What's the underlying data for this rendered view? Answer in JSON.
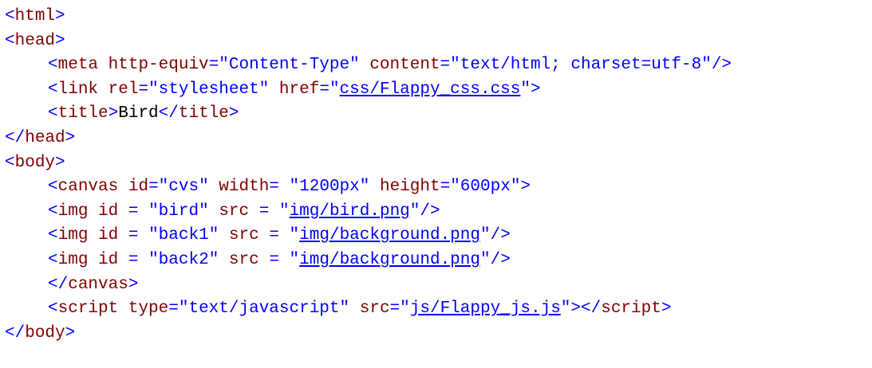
{
  "editor": {
    "lines": [
      {
        "indent": 0,
        "tokens": [
          {
            "kind": "punct",
            "text": "<"
          },
          {
            "kind": "tag",
            "text": "html"
          },
          {
            "kind": "punct",
            "text": ">"
          }
        ]
      },
      {
        "indent": 0,
        "tokens": [
          {
            "kind": "punct",
            "text": "<"
          },
          {
            "kind": "tag",
            "text": "head"
          },
          {
            "kind": "punct",
            "text": ">"
          }
        ]
      },
      {
        "indent": 1,
        "tokens": [
          {
            "kind": "punct",
            "text": "<"
          },
          {
            "kind": "tag",
            "text": "meta"
          },
          {
            "kind": "text",
            "text": " "
          },
          {
            "kind": "attr",
            "text": "http-equiv"
          },
          {
            "kind": "punct",
            "text": "="
          },
          {
            "kind": "value",
            "text": "\"Content-Type\""
          },
          {
            "kind": "text",
            "text": " "
          },
          {
            "kind": "attr",
            "text": "content"
          },
          {
            "kind": "punct",
            "text": "="
          },
          {
            "kind": "value",
            "text": "\"text/html; charset=utf-8\""
          },
          {
            "kind": "punct",
            "text": "/>"
          }
        ]
      },
      {
        "indent": 1,
        "tokens": [
          {
            "kind": "punct",
            "text": "<"
          },
          {
            "kind": "tag",
            "text": "link"
          },
          {
            "kind": "text",
            "text": " "
          },
          {
            "kind": "attr",
            "text": "rel"
          },
          {
            "kind": "punct",
            "text": "="
          },
          {
            "kind": "value",
            "text": "\"stylesheet\""
          },
          {
            "kind": "text",
            "text": " "
          },
          {
            "kind": "attr",
            "text": "href"
          },
          {
            "kind": "punct",
            "text": "="
          },
          {
            "kind": "value",
            "text": "\""
          },
          {
            "kind": "link",
            "text": "css/Flappy_css.css"
          },
          {
            "kind": "value",
            "text": "\""
          },
          {
            "kind": "punct",
            "text": ">"
          }
        ]
      },
      {
        "indent": 1,
        "tokens": [
          {
            "kind": "punct",
            "text": "<"
          },
          {
            "kind": "tag",
            "text": "title"
          },
          {
            "kind": "punct",
            "text": ">"
          },
          {
            "kind": "text",
            "text": "Bird"
          },
          {
            "kind": "punct",
            "text": "</"
          },
          {
            "kind": "tag",
            "text": "title"
          },
          {
            "kind": "punct",
            "text": ">"
          }
        ]
      },
      {
        "indent": 0,
        "tokens": [
          {
            "kind": "punct",
            "text": "</"
          },
          {
            "kind": "tag",
            "text": "head"
          },
          {
            "kind": "punct",
            "text": ">"
          }
        ]
      },
      {
        "indent": 0,
        "tokens": [
          {
            "kind": "punct",
            "text": "<"
          },
          {
            "kind": "tag",
            "text": "body"
          },
          {
            "kind": "punct",
            "text": ">"
          }
        ]
      },
      {
        "indent": 1,
        "tokens": [
          {
            "kind": "punct",
            "text": "<"
          },
          {
            "kind": "tag",
            "text": "canvas"
          },
          {
            "kind": "text",
            "text": " "
          },
          {
            "kind": "attr",
            "text": "id"
          },
          {
            "kind": "punct",
            "text": "="
          },
          {
            "kind": "value",
            "text": "\"cvs\""
          },
          {
            "kind": "text",
            "text": " "
          },
          {
            "kind": "attr",
            "text": "width"
          },
          {
            "kind": "punct",
            "text": "="
          },
          {
            "kind": "text",
            "text": " "
          },
          {
            "kind": "value",
            "text": "\"1200px\""
          },
          {
            "kind": "text",
            "text": " "
          },
          {
            "kind": "attr",
            "text": "height"
          },
          {
            "kind": "punct",
            "text": "="
          },
          {
            "kind": "value",
            "text": "\"600px\""
          },
          {
            "kind": "punct",
            "text": ">"
          }
        ]
      },
      {
        "indent": 1,
        "tokens": [
          {
            "kind": "punct",
            "text": "<"
          },
          {
            "kind": "tag",
            "text": "img"
          },
          {
            "kind": "text",
            "text": " "
          },
          {
            "kind": "attr",
            "text": "id"
          },
          {
            "kind": "text",
            "text": " "
          },
          {
            "kind": "punct",
            "text": "="
          },
          {
            "kind": "text",
            "text": " "
          },
          {
            "kind": "value",
            "text": "\"bird\""
          },
          {
            "kind": "text",
            "text": " "
          },
          {
            "kind": "attr",
            "text": "src"
          },
          {
            "kind": "text",
            "text": " "
          },
          {
            "kind": "punct",
            "text": "="
          },
          {
            "kind": "text",
            "text": " "
          },
          {
            "kind": "value",
            "text": "\""
          },
          {
            "kind": "link",
            "text": "img/bird.png"
          },
          {
            "kind": "value",
            "text": "\""
          },
          {
            "kind": "punct",
            "text": "/>"
          }
        ]
      },
      {
        "indent": 1,
        "tokens": [
          {
            "kind": "punct",
            "text": "<"
          },
          {
            "kind": "tag",
            "text": "img"
          },
          {
            "kind": "text",
            "text": " "
          },
          {
            "kind": "attr",
            "text": "id"
          },
          {
            "kind": "text",
            "text": " "
          },
          {
            "kind": "punct",
            "text": "="
          },
          {
            "kind": "text",
            "text": " "
          },
          {
            "kind": "value",
            "text": "\"back1\""
          },
          {
            "kind": "text",
            "text": " "
          },
          {
            "kind": "attr",
            "text": "src"
          },
          {
            "kind": "text",
            "text": " "
          },
          {
            "kind": "punct",
            "text": "="
          },
          {
            "kind": "text",
            "text": " "
          },
          {
            "kind": "value",
            "text": "\""
          },
          {
            "kind": "link",
            "text": "img/background.png"
          },
          {
            "kind": "value",
            "text": "\""
          },
          {
            "kind": "punct",
            "text": "/>"
          }
        ]
      },
      {
        "indent": 1,
        "tokens": [
          {
            "kind": "punct",
            "text": "<"
          },
          {
            "kind": "tag",
            "text": "img"
          },
          {
            "kind": "text",
            "text": " "
          },
          {
            "kind": "attr",
            "text": "id"
          },
          {
            "kind": "text",
            "text": " "
          },
          {
            "kind": "punct",
            "text": "="
          },
          {
            "kind": "text",
            "text": " "
          },
          {
            "kind": "value",
            "text": "\"back2\""
          },
          {
            "kind": "text",
            "text": " "
          },
          {
            "kind": "attr",
            "text": "src"
          },
          {
            "kind": "text",
            "text": " "
          },
          {
            "kind": "punct",
            "text": "="
          },
          {
            "kind": "text",
            "text": " "
          },
          {
            "kind": "value",
            "text": "\""
          },
          {
            "kind": "link",
            "text": "img/background.png"
          },
          {
            "kind": "value",
            "text": "\""
          },
          {
            "kind": "punct",
            "text": "/>"
          }
        ]
      },
      {
        "indent": 1,
        "tokens": [
          {
            "kind": "punct",
            "text": "</"
          },
          {
            "kind": "tag",
            "text": "canvas"
          },
          {
            "kind": "punct",
            "text": ">"
          }
        ]
      },
      {
        "indent": 1,
        "tokens": [
          {
            "kind": "punct",
            "text": "<"
          },
          {
            "kind": "tag",
            "text": "script"
          },
          {
            "kind": "text",
            "text": " "
          },
          {
            "kind": "attr",
            "text": "type"
          },
          {
            "kind": "punct",
            "text": "="
          },
          {
            "kind": "value",
            "text": "\"text/javascript\""
          },
          {
            "kind": "text",
            "text": " "
          },
          {
            "kind": "attr",
            "text": "src"
          },
          {
            "kind": "punct",
            "text": "="
          },
          {
            "kind": "value",
            "text": "\""
          },
          {
            "kind": "link",
            "text": "js/Flappy_js.js"
          },
          {
            "kind": "value",
            "text": "\""
          },
          {
            "kind": "punct",
            "text": "></"
          },
          {
            "kind": "tag",
            "text": "script"
          },
          {
            "kind": "punct",
            "text": ">"
          }
        ]
      },
      {
        "indent": 0,
        "tokens": [
          {
            "kind": "punct",
            "text": "</"
          },
          {
            "kind": "tag",
            "text": "body"
          },
          {
            "kind": "punct",
            "text": ">"
          }
        ]
      }
    ]
  }
}
